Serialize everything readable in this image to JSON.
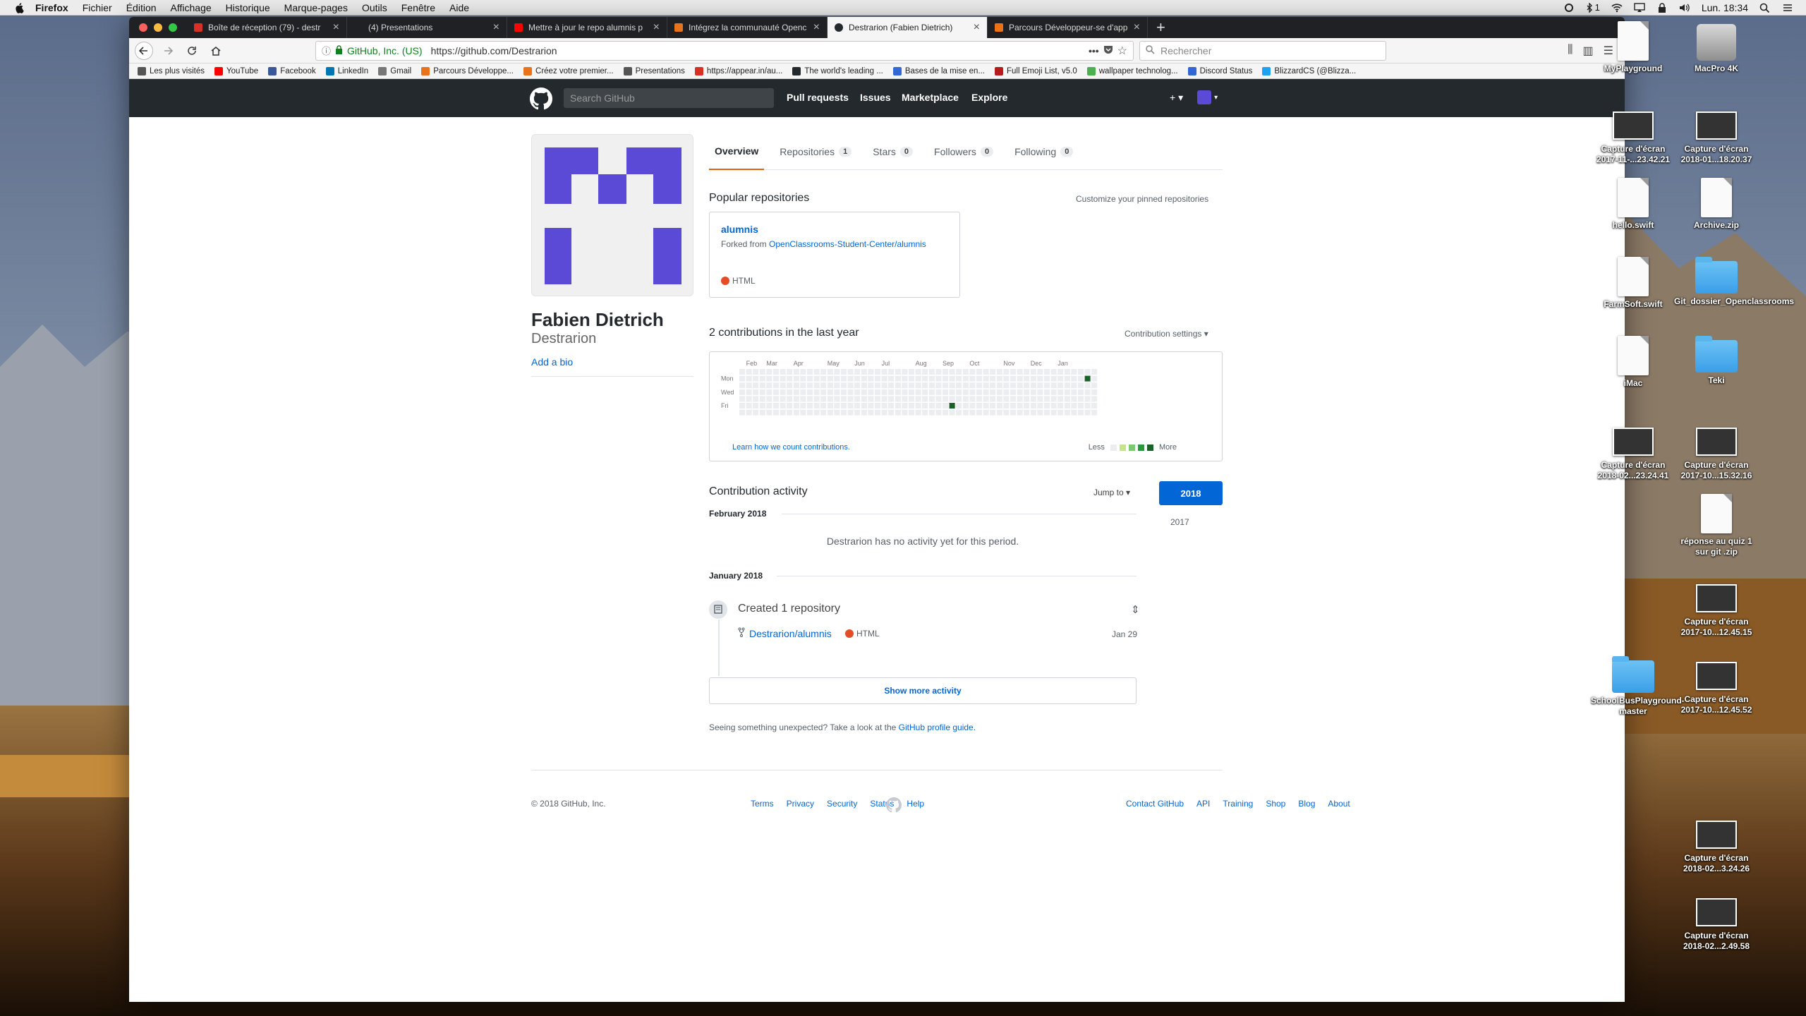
{
  "menubar": {
    "items": [
      "Firefox",
      "Fichier",
      "Édition",
      "Affichage",
      "Historique",
      "Marque-pages",
      "Outils",
      "Fenêtre",
      "Aide"
    ],
    "badge": "1",
    "clock": "Lun. 18:34"
  },
  "tabs": [
    {
      "title": "Boîte de réception (79) - destr",
      "color": "#d93025"
    },
    {
      "title": "(4) Presentations",
      "color": "#444444"
    },
    {
      "title": "Mettre à jour le repo alumnis p",
      "color": "#ff0000"
    },
    {
      "title": "Intégrez la communauté Openc",
      "color": "#e8731b"
    },
    {
      "title": "Destrarion (Fabien Dietrich)",
      "color": "#24292e"
    },
    {
      "title": "Parcours Développeur-se d'app",
      "color": "#e8731b"
    }
  ],
  "urlbar": {
    "identity": "GitHub, Inc. (US)",
    "url": "https://github.com/Destrarion"
  },
  "searchbar": {
    "placeholder": "Rechercher"
  },
  "bookmarks": [
    {
      "label": "Les plus visités",
      "color": "#555555"
    },
    {
      "label": "YouTube",
      "color": "#ff0000"
    },
    {
      "label": "Facebook",
      "color": "#3b5998"
    },
    {
      "label": "LinkedIn",
      "color": "#0077b5"
    },
    {
      "label": "Gmail",
      "color": "#777777"
    },
    {
      "label": "Parcours Développe...",
      "color": "#e8731b"
    },
    {
      "label": "Créez votre premier...",
      "color": "#e8731b"
    },
    {
      "label": "Presentations",
      "color": "#555555"
    },
    {
      "label": "https://appear.in/au...",
      "color": "#d93025"
    },
    {
      "label": "The world's leading ...",
      "color": "#24292e"
    },
    {
      "label": "Bases de la mise en...",
      "color": "#3367d6"
    },
    {
      "label": "Full Emoji List, v5.0",
      "color": "#b71c1c"
    },
    {
      "label": "wallpaper technolog...",
      "color": "#4caf50"
    },
    {
      "label": "Discord Status",
      "color": "#3367d6"
    },
    {
      "label": "BlizzardCS (@Blizza...",
      "color": "#1da1f2"
    }
  ],
  "github": {
    "search_placeholder": "Search GitHub",
    "nav": [
      "Pull requests",
      "Issues",
      "Marketplace",
      "Explore"
    ],
    "profile": {
      "name": "Fabien Dietrich",
      "login": "Destrarion",
      "add_bio": "Add a bio"
    },
    "profile_tabs": [
      {
        "label": "Overview",
        "count": ""
      },
      {
        "label": "Repositories",
        "count": "1"
      },
      {
        "label": "Stars",
        "count": "0"
      },
      {
        "label": "Followers",
        "count": "0"
      },
      {
        "label": "Following",
        "count": "0"
      }
    ],
    "popular": {
      "title": "Popular repositories",
      "customize": "Customize your pinned repositories",
      "repo_name": "alumnis",
      "fork_prefix": "Forked from",
      "fork_source": "OpenClassrooms-Student-Center/alumnis",
      "language": "HTML",
      "language_color": "#e34c26"
    },
    "contributions": {
      "title": "2 contributions in the last year",
      "settings": "Contribution settings ▾",
      "months": [
        "Feb",
        "Mar",
        "Apr",
        "May",
        "Jun",
        "Jul",
        "Aug",
        "Sep",
        "Oct",
        "Nov",
        "Dec",
        "Jan"
      ],
      "days": [
        "Mon",
        "Wed",
        "Fri"
      ],
      "learn": "Learn how we count contributions.",
      "less": "Less",
      "more": "More",
      "active_cells": [
        {
          "week": 31,
          "day": 5
        },
        {
          "week": 51,
          "day": 1
        }
      ],
      "empty_color": "#ebedf0",
      "active_color": "#196127",
      "legend_colors": [
        "#ebedf0",
        "#c6e48b",
        "#7bc96f",
        "#239a3b",
        "#196127"
      ]
    },
    "activity": {
      "title": "Contribution activity",
      "jump": "Jump to ▾",
      "years": [
        "2018",
        "2017"
      ],
      "feb_header": "February 2018",
      "no_activity": "Destrarion has no activity yet for this period.",
      "jan_header": "January 2018",
      "created": "Created 1 repository",
      "repo": "Destrarion/alumnis",
      "repo_lang": "HTML",
      "date": "Jan 29",
      "show_more": "Show more activity",
      "unexpected_prefix": "Seeing something unexpected? Take a look at the",
      "unexpected_link": "GitHub profile guide."
    },
    "footer": {
      "copyright": "© 2018 GitHub, Inc.",
      "left_links": [
        "Terms",
        "Privacy",
        "Security",
        "Status",
        "Help"
      ],
      "right_links": [
        "Contact GitHub",
        "API",
        "Training",
        "Shop",
        "Blog",
        "About"
      ]
    }
  },
  "desktop_icons": [
    {
      "label": "MyPlayground",
      "kind": "doc"
    },
    {
      "label": "MacPro 4K",
      "kind": "disk"
    },
    {
      "label": "Capture d'écran 2017-11-...23.42.21",
      "kind": "shot"
    },
    {
      "label": "Capture d'écran 2018-01...18.20.37",
      "kind": "shot"
    },
    {
      "label": "hello.swift",
      "kind": "doc"
    },
    {
      "label": "Archive.zip",
      "kind": "doc"
    },
    {
      "label": "FarmSoft.swift",
      "kind": "doc"
    },
    {
      "label": "Git_dossier_Openclassrooms",
      "kind": "folder"
    },
    {
      "label": "iMac",
      "kind": "doc"
    },
    {
      "label": "Teki",
      "kind": "folder"
    },
    {
      "label": "Capture d'écran 2018-02...23.24.41",
      "kind": "shot"
    },
    {
      "label": "Capture d'écran 2017-10...15.32.16",
      "kind": "shot"
    },
    {
      "label": "réponse au quiz 1 sur git .zip",
      "kind": "doc"
    },
    {
      "label": "Capture d'écran 2017-10...12.45.15",
      "kind": "shot"
    },
    {
      "label": "SchoolBusPlayground-master",
      "kind": "folder"
    },
    {
      "label": "Capture d'écran 2017-10...12.45.52",
      "kind": "shot"
    },
    {
      "label": "Capture d'écran 2018-02...3.24.26",
      "kind": "shot"
    },
    {
      "label": "Capture d'écran 2018-02...2.49.58",
      "kind": "shot"
    }
  ]
}
